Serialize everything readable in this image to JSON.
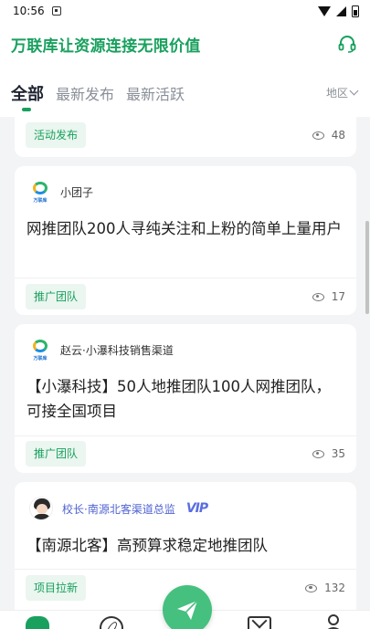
{
  "status_bar": {
    "time": "10:56"
  },
  "header": {
    "title": "万联库让资源连接无限价值"
  },
  "tabs": [
    {
      "label": "全部",
      "active": true
    },
    {
      "label": "最新发布",
      "active": false
    },
    {
      "label": "最新活跃",
      "active": false
    }
  ],
  "region": {
    "label": "地区"
  },
  "posts": [
    {
      "author": "",
      "content": "",
      "tag": "活动发布",
      "views": "48"
    },
    {
      "author": "小团子",
      "avatar_text": "万联库",
      "content": "网推团队200人寻纯关注和上粉的简单上量用户",
      "tag": "推广团队",
      "views": "17"
    },
    {
      "author": "赵云·小瀑科技销售渠道",
      "avatar_text": "万联库",
      "content": "【小瀑科技】50人地推团队100人网推团队，可接全国项目",
      "tag": "推广团队",
      "views": "35"
    },
    {
      "author": "校长·南源北客渠道总监",
      "badge": "VIP",
      "content": "【南源北客】高预算求稳定地推团队",
      "tag": "项目拉新",
      "views": "132"
    }
  ],
  "colors": {
    "brand_green": "#19a05e",
    "fab_green": "#46c07f",
    "vip_blue": "#5b6ee0"
  },
  "icons": [
    "headset-icon",
    "eye-icon",
    "home-icon",
    "compass-icon",
    "send-icon",
    "mail-icon",
    "user-icon",
    "chevron-down-icon"
  ]
}
